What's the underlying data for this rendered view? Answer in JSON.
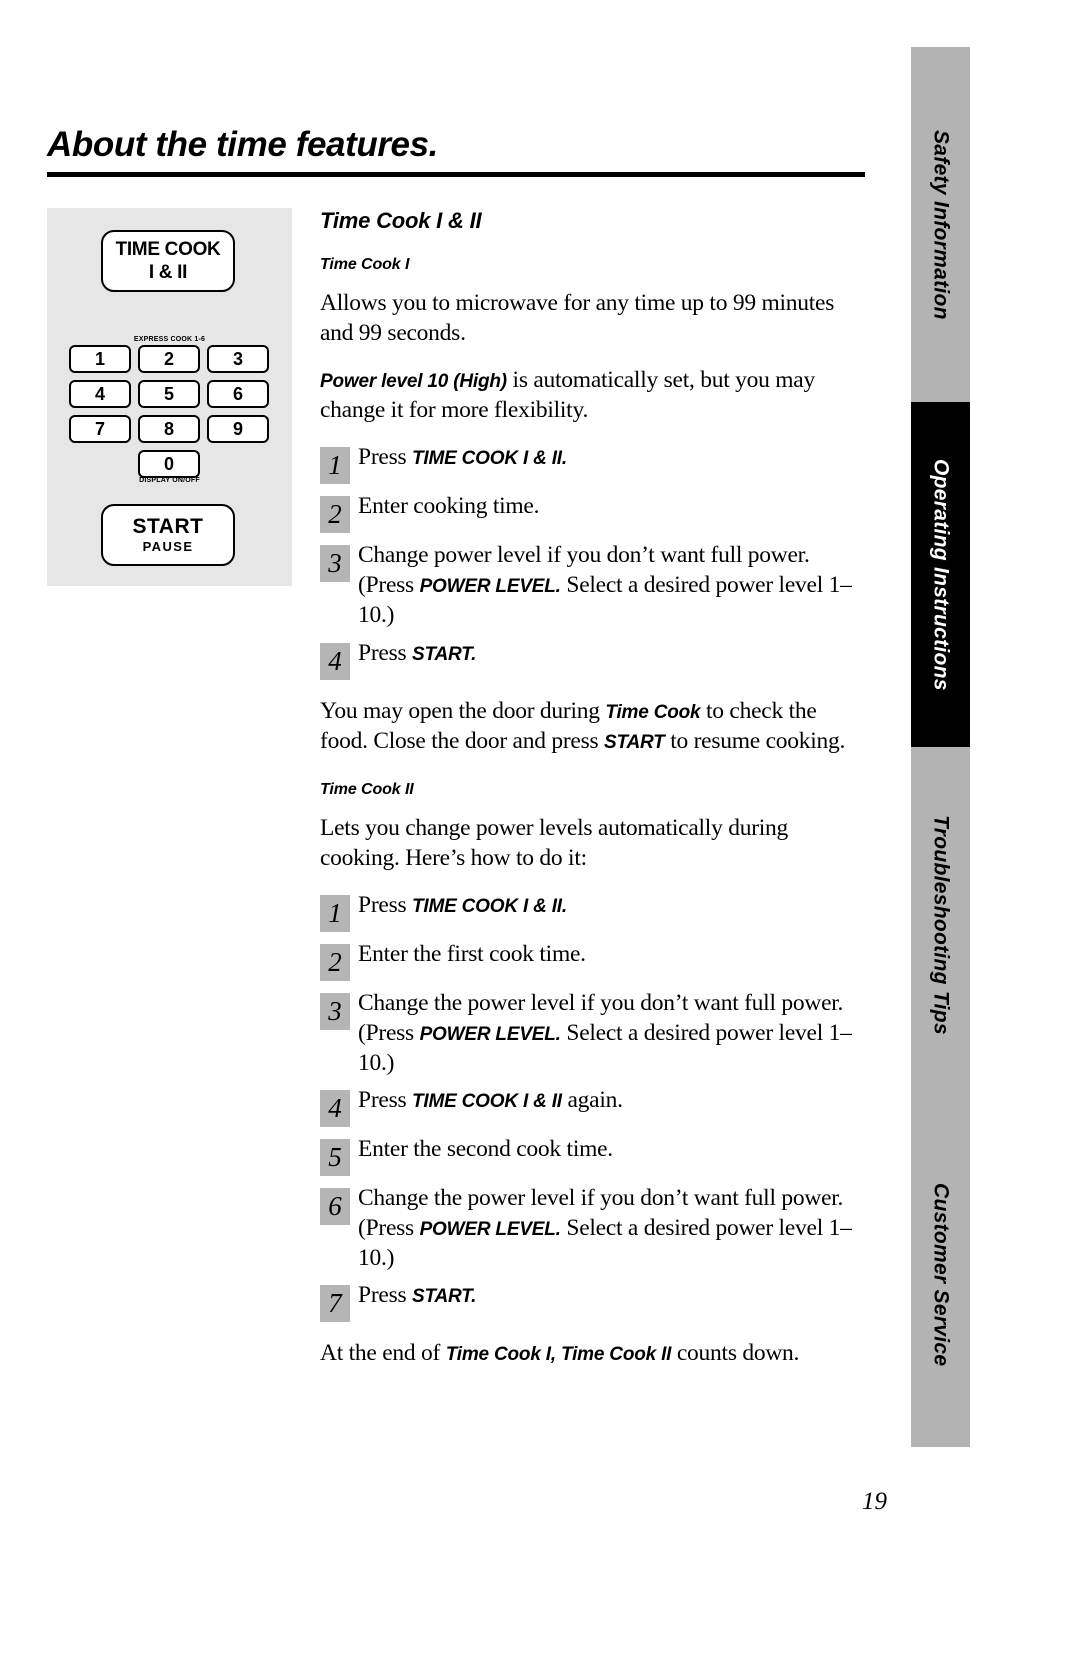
{
  "page": {
    "title": "About the time features.",
    "number": "19"
  },
  "side_tabs": [
    {
      "label": "Safety Information",
      "style": "grey"
    },
    {
      "label": "Operating Instructions",
      "style": "black"
    },
    {
      "label": "Troubleshooting Tips",
      "style": "grey"
    },
    {
      "label": "Customer Service",
      "style": "grey"
    }
  ],
  "control_panel": {
    "time_cook_button": {
      "line1": "TIME COOK",
      "line2": "I & II"
    },
    "express_cook_label": "EXPRESS COOK  1-6",
    "display_onoff_label": "DISPLAY ON/OFF",
    "keys": [
      "1",
      "2",
      "3",
      "4",
      "5",
      "6",
      "7",
      "8",
      "9",
      "0"
    ],
    "start_button": {
      "line1": "START",
      "line2": "PAUSE"
    }
  },
  "content": {
    "section_heading": "Time Cook I & II",
    "time_cook_1": {
      "heading": "Time Cook I",
      "intro": "Allows you to microwave for any time up to 99 minutes and 99 seconds.",
      "power_note_bold": "Power level 10 (High)",
      "power_note_rest": " is automatically set, but you may change it for more flexibility.",
      "steps": [
        {
          "num": "1",
          "pre": "Press ",
          "bold": "TIME COOK I & II.",
          "post": ""
        },
        {
          "num": "2",
          "pre": "Enter cooking time.",
          "bold": "",
          "post": ""
        },
        {
          "num": "3",
          "pre": "Change power level if you don’t want full power. (Press ",
          "bold": "POWER LEVEL.",
          "post": " Select a desired power level 1–10.)"
        },
        {
          "num": "4",
          "pre": "Press ",
          "bold": "START.",
          "post": ""
        }
      ],
      "door_note_a": "You may open the door during ",
      "door_note_b": "Time Cook",
      "door_note_c": " to check the food. Close the door and press ",
      "door_note_d": "START",
      "door_note_e": " to resume cooking."
    },
    "time_cook_2": {
      "heading": "Time Cook II",
      "intro": "Lets you change power levels automatically during cooking. Here’s how to do it:",
      "steps": [
        {
          "num": "1",
          "pre": "Press ",
          "bold": "TIME COOK I & II.",
          "post": ""
        },
        {
          "num": "2",
          "pre": "Enter the first cook time.",
          "bold": "",
          "post": ""
        },
        {
          "num": "3",
          "pre": "Change the power level if you don’t want full power. (Press ",
          "bold": "POWER LEVEL.",
          "post": " Select a desired power level 1–10.)"
        },
        {
          "num": "4",
          "pre": "Press ",
          "bold": "TIME COOK I & II",
          "post": " again."
        },
        {
          "num": "5",
          "pre": "Enter the second cook time.",
          "bold": "",
          "post": ""
        },
        {
          "num": "6",
          "pre": "Change the power level if you don’t want full power. (Press ",
          "bold": "POWER LEVEL.",
          "post": " Select a desired power level 1–10.)"
        },
        {
          "num": "7",
          "pre": "Press ",
          "bold": "START.",
          "post": ""
        }
      ],
      "closing_a": "At the end of ",
      "closing_b": "Time Cook I, Time Cook II",
      "closing_c": " counts down."
    }
  }
}
